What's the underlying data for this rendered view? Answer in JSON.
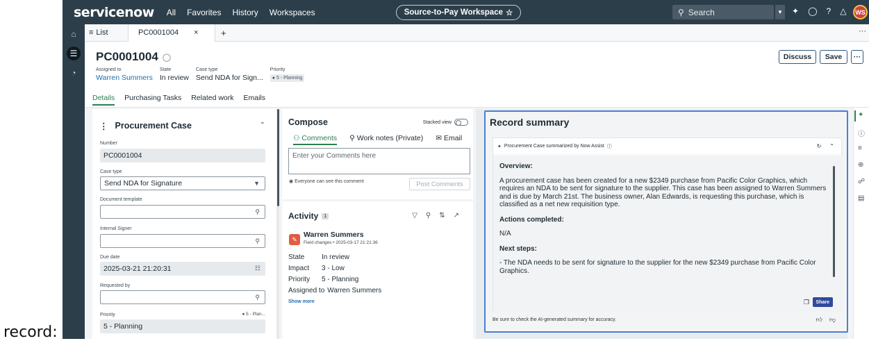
{
  "gutter": {
    "label": "record:"
  },
  "topbar": {
    "logo": "servicenow",
    "nav": [
      "All",
      "Favorites",
      "History",
      "Workspaces"
    ],
    "workspace": "Source-to-Pay Workspace",
    "workspace_star": "☆",
    "search_placeholder": "Search",
    "avatar_initials": "WS"
  },
  "tabs": {
    "list_label": "List",
    "record_tab": "PC0001004",
    "close": "×",
    "add": "+",
    "more": "···"
  },
  "header": {
    "title": "PC0001004",
    "meta": [
      {
        "label": "Assigned to",
        "value": "Warren Summers"
      },
      {
        "label": "State",
        "value": "In review"
      },
      {
        "label": "Case type",
        "value": "Send NDA for Sign..."
      },
      {
        "label": "Priority",
        "value": "5 - Planning"
      }
    ],
    "discuss": "Discuss",
    "save": "Save",
    "more": "···",
    "subtabs": [
      "Details",
      "Purchasing Tasks",
      "Related work",
      "Emails"
    ]
  },
  "details": {
    "section_title": "Procurement Case",
    "fields": {
      "number_label": "Number",
      "number_value": "PC0001004",
      "case_type_label": "Case type",
      "case_type_value": "Send NDA for Signature",
      "doc_template_label": "Document template",
      "internal_signer_label": "Internal Signer",
      "due_date_label": "Due date",
      "due_date_value": "2025-03-21 21:20:31",
      "requested_by_label": "Requested by",
      "priority_label": "Priority",
      "priority_badge": "5 - Plan...",
      "priority_value": "5 - Planning"
    }
  },
  "compose": {
    "title": "Compose",
    "stacked_view": "Stacked view",
    "tabs": [
      "Comments",
      "Work notes (Private)",
      "Email"
    ],
    "placeholder": "Enter your Comments here",
    "everyone": "Everyone can see this comment",
    "post": "Post Comments"
  },
  "activity": {
    "title": "Activity",
    "count": "1",
    "name": "Warren Summers",
    "sub": "Field changes • 2025-03-17 21:21:36",
    "rows": [
      {
        "k": "State",
        "v": "In review"
      },
      {
        "k": "Impact",
        "v": "3 - Low"
      },
      {
        "k": "Priority",
        "v": "5 - Planning"
      },
      {
        "k": "Assigned to",
        "v": "Warren Summers"
      }
    ],
    "show_more": "Show more"
  },
  "summary": {
    "title": "Record summary",
    "card_head": "Procurement Case summarized by Now Assist",
    "overview_h": "Overview:",
    "overview": "A procurement case has been created for a new $2349 purchase from Pacific Color Graphics, which requires an NDA to be sent for signature to the supplier. This case has been assigned to Warren Summers and is due by March 21st. The business owner, Alan Edwards, is requesting this purchase, which is classified as a net new requisition type.",
    "actions_h": "Actions completed:",
    "actions": "N/A",
    "next_h": "Next steps:",
    "next": "- The NDA needs to be sent for signature to the supplier for the new $2349 purchase from Pacific Color Graphics.",
    "share": "Share",
    "disclaimer": "Be sure to check the AI-generated summary for accuracy."
  }
}
